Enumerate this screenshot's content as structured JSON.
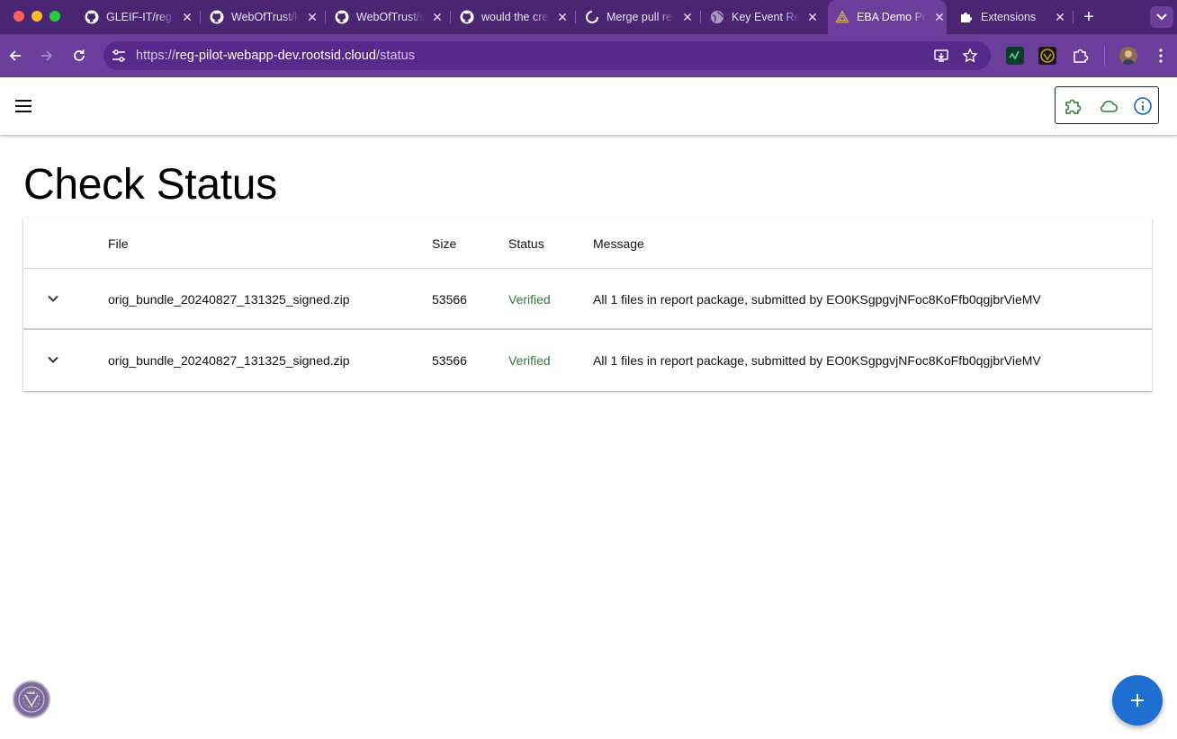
{
  "browser": {
    "tabs": [
      {
        "title": "GLEIF-IT/reg-pilot",
        "icon": "github-icon",
        "active": false
      },
      {
        "title": "WebOfTrust/keria",
        "icon": "github-icon",
        "active": false
      },
      {
        "title": "WebOfTrust/signify",
        "icon": "github-icon",
        "active": false
      },
      {
        "title": "would the credential",
        "icon": "github-icon",
        "active": false
      },
      {
        "title": "Merge pull request",
        "icon": "github-sync-icon",
        "active": false
      },
      {
        "title": "Key Event Receipt",
        "icon": "globe-icon",
        "active": false
      },
      {
        "title": "EBA Demo Portal",
        "icon": "triangle-logo-icon",
        "active": true
      },
      {
        "title": "Extensions",
        "icon": "puzzle-icon",
        "active": false
      }
    ],
    "url_scheme": "https://",
    "url_host": "reg-pilot-webapp-dev.rootsid.cloud",
    "url_path": "/status"
  },
  "page": {
    "title": "Check Status"
  },
  "table": {
    "columns": [
      "File",
      "Size",
      "Status",
      "Message"
    ],
    "rows": [
      {
        "file": "orig_bundle_20240827_131325_signed.zip",
        "size": "53566",
        "status": "Verified",
        "message": "All 1 files in report package, submitted by EO0KSgpgvjNFoc8KoFfb0qgjbrVieMV"
      },
      {
        "file": "orig_bundle_20240827_131325_signed.zip",
        "size": "53566",
        "status": "Verified",
        "message": "All 1 files in report package, submitted by EO0KSgpgvjNFoc8KoFfb0qgjbrVieMV"
      }
    ]
  },
  "colors": {
    "browser_frame": "#4a2672",
    "toolbar": "#6b3e9c",
    "verified": "#2e7d32",
    "fab": "#1f6fd1",
    "connection_icons": "#2e7d32",
    "info_icon": "#1565c0"
  }
}
